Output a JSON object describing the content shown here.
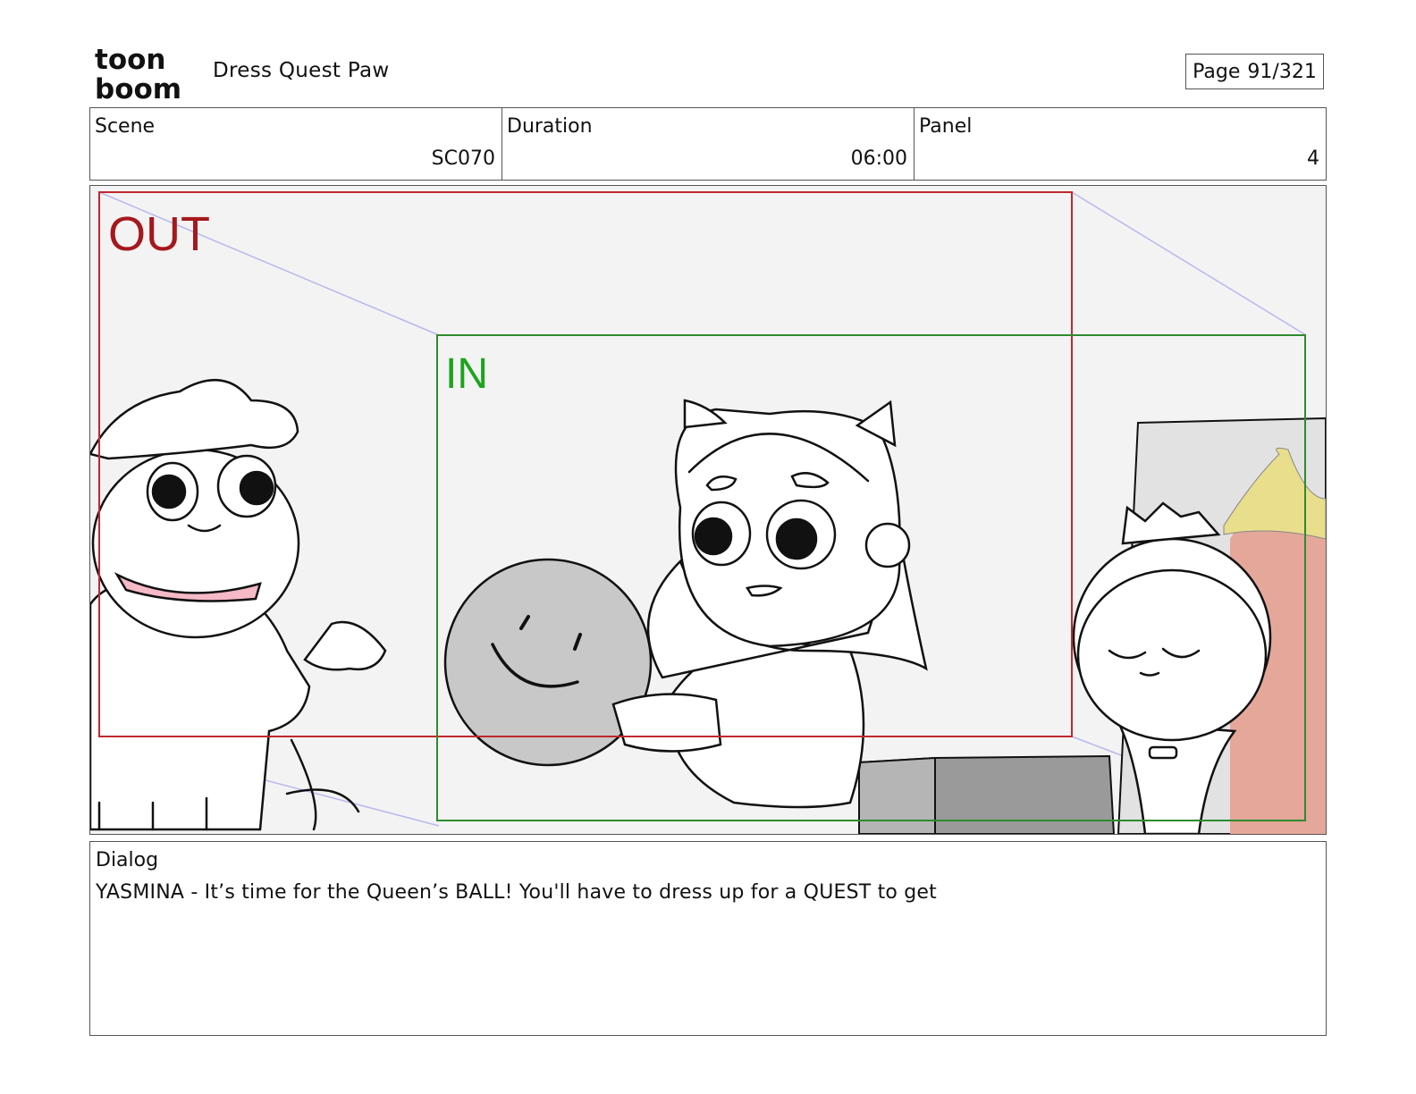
{
  "header": {
    "logo": {
      "icon": "toonboom-logo",
      "line1": "toon",
      "line2": "boom"
    },
    "project_title": "Dress Quest Paw",
    "page": {
      "label": "Page",
      "value": "91/321"
    }
  },
  "info": {
    "scene": {
      "label": "Scene",
      "value": "SC070"
    },
    "duration": {
      "label": "Duration",
      "value": "06:00"
    },
    "panel": {
      "label": "Panel",
      "value": "4"
    }
  },
  "panel_image": {
    "out_label": "OUT",
    "in_label": "IN",
    "colors": {
      "out_frame": "#c0282d",
      "in_frame": "#2e8b2e",
      "guide_lines": "#b8b8ee",
      "background": "#f3f3f3",
      "ball": "#c8c8c8",
      "scarf": "#f6b9c6",
      "curtain": "#e4a79a",
      "tassel": "#e8de8c"
    }
  },
  "dialog": {
    "label": "Dialog",
    "text": "YASMINA - It’s time for the Queen’s BALL! You'll have to dress up for a QUEST to get"
  }
}
